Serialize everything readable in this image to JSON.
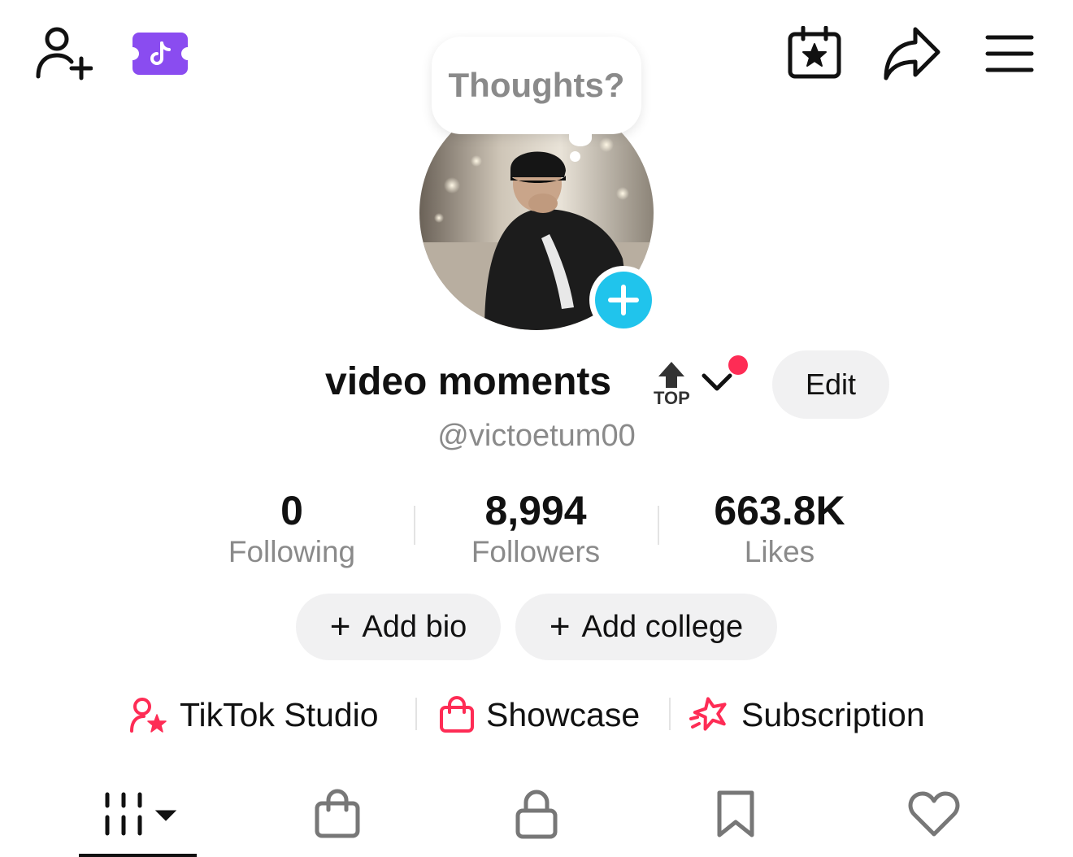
{
  "top_bar": {
    "icons": [
      "add-friend-icon",
      "tiktok-coin-ticket-icon",
      "calendar-star-icon",
      "share-icon",
      "menu-icon"
    ],
    "ticket_color": "#8a4cf0"
  },
  "bubble": {
    "text": "Thoughts?"
  },
  "profile": {
    "name": "video moments",
    "top_badge": "TOP",
    "handle": "@victoetum00",
    "edit_label": "Edit",
    "accent": "#fe2c55",
    "add_color": "#20c4ec"
  },
  "stats": [
    {
      "value": "0",
      "label": "Following"
    },
    {
      "value": "8,994",
      "label": "Followers"
    },
    {
      "value": "663.8K",
      "label": "Likes"
    }
  ],
  "actions": {
    "add_bio": "Add bio",
    "add_college": "Add college",
    "plus": "+"
  },
  "links": [
    {
      "label": "TikTok Studio",
      "icon": "creator-star-icon"
    },
    {
      "label": "Showcase",
      "icon": "shopping-bag-icon"
    },
    {
      "label": "Subscription",
      "icon": "subscription-star-icon"
    }
  ],
  "tabs": [
    "videos-grid-icon",
    "shop-bag-icon",
    "private-lock-icon",
    "bookmark-icon",
    "liked-heart-icon"
  ]
}
